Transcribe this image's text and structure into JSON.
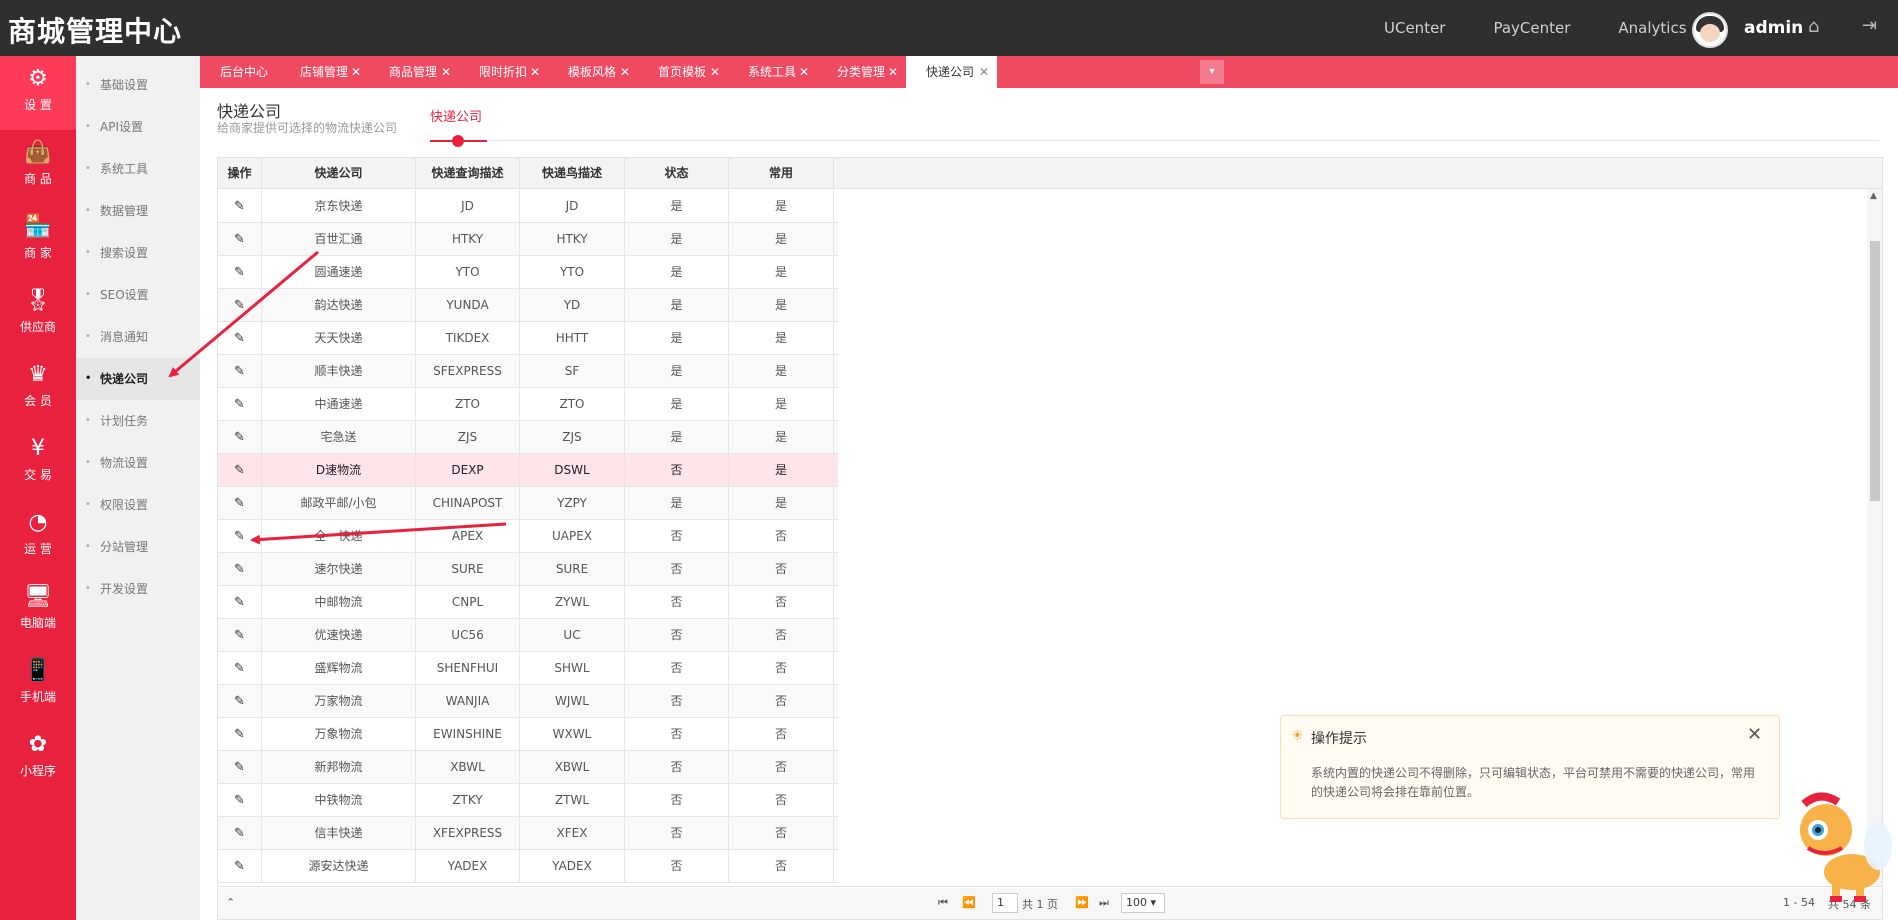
{
  "header": {
    "brand": "商城管理中心",
    "links": [
      "UCenter",
      "PayCenter",
      "Analytics"
    ],
    "username": "admin"
  },
  "mainnav": [
    {
      "label": "设 置",
      "icon": "gear-icon",
      "glyph": "⚙"
    },
    {
      "label": "商 品",
      "icon": "bag-icon",
      "glyph": "👜"
    },
    {
      "label": "商 家",
      "icon": "store-icon",
      "glyph": "🏪"
    },
    {
      "label": "供应商",
      "icon": "badge-icon",
      "glyph": "🎖"
    },
    {
      "label": "会 员",
      "icon": "crown-icon",
      "glyph": "♛"
    },
    {
      "label": "交 易",
      "icon": "yen-icon",
      "glyph": "¥"
    },
    {
      "label": "运 营",
      "icon": "pie-chart-icon",
      "glyph": "◔"
    },
    {
      "label": "电脑端",
      "icon": "monitor-icon",
      "glyph": "🖥"
    },
    {
      "label": "手机端",
      "icon": "phone-icon",
      "glyph": "📱"
    },
    {
      "label": "小程序",
      "icon": "miniprogram-icon",
      "glyph": "✿"
    }
  ],
  "subnav": [
    "基础设置",
    "API设置",
    "系统工具",
    "数据管理",
    "搜索设置",
    "SEO设置",
    "消息通知",
    "快递公司",
    "计划任务",
    "物流设置",
    "权限设置",
    "分站管理",
    "开发设置"
  ],
  "tabs": [
    "后台中心",
    "店铺管理",
    "商品管理",
    "限时折扣",
    "模板风格",
    "首页模板",
    "系统工具",
    "分类管理",
    "快递公司"
  ],
  "page": {
    "title": "快递公司",
    "subtitle": "给商家提供可选择的物流快递公司",
    "tab": "快递公司"
  },
  "table": {
    "columns": [
      "操作",
      "快递公司",
      "快递查询描述",
      "快递鸟描述",
      "状态",
      "常用"
    ],
    "rows": [
      [
        "京东快递",
        "JD",
        "JD",
        "是",
        "是"
      ],
      [
        "百世汇通",
        "HTKY",
        "HTKY",
        "是",
        "是"
      ],
      [
        "圆通速递",
        "YTO",
        "YTO",
        "是",
        "是"
      ],
      [
        "韵达快递",
        "YUNDA",
        "YD",
        "是",
        "是"
      ],
      [
        "天天快递",
        "TIKDEX",
        "HHTT",
        "是",
        "是"
      ],
      [
        "顺丰快递",
        "SFEXPRESS",
        "SF",
        "是",
        "是"
      ],
      [
        "中通速递",
        "ZTO",
        "ZTO",
        "是",
        "是"
      ],
      [
        "宅急送",
        "ZJS",
        "ZJS",
        "是",
        "是"
      ],
      [
        "D速物流",
        "DEXP",
        "DSWL",
        "否",
        "是"
      ],
      [
        "邮政平邮/小包",
        "CHINAPOST",
        "YZPY",
        "是",
        "是"
      ],
      [
        "全一快递",
        "APEX",
        "UAPEX",
        "否",
        "否"
      ],
      [
        "速尔快递",
        "SURE",
        "SURE",
        "否",
        "否"
      ],
      [
        "中邮物流",
        "CNPL",
        "ZYWL",
        "否",
        "否"
      ],
      [
        "优速快递",
        "UC56",
        "UC",
        "否",
        "否"
      ],
      [
        "盛辉物流",
        "SHENFHUI",
        "SHWL",
        "否",
        "否"
      ],
      [
        "万家物流",
        "WANJIA",
        "WJWL",
        "否",
        "否"
      ],
      [
        "万象物流",
        "EWINSHINE",
        "WXWL",
        "否",
        "否"
      ],
      [
        "新邦物流",
        "XBWL",
        "XBWL",
        "否",
        "否"
      ],
      [
        "中铁物流",
        "ZTKY",
        "ZTWL",
        "否",
        "否"
      ],
      [
        "信丰快递",
        "XFEXPRESS",
        "XFEX",
        "否",
        "否"
      ],
      [
        "源安达快递",
        "YADEX",
        "YADEX",
        "否",
        "否"
      ]
    ]
  },
  "pager": {
    "page": "1",
    "total_pages": "共 1 页",
    "page_size": "100",
    "range": "1 - 54",
    "count": "共 54 条"
  },
  "tip": {
    "title": "操作提示",
    "text": "系统内置的快递公司不得删除，只可编辑状态，平台可禁用不需要的快递公司，常用的快递公司将会排在靠前位置。"
  },
  "colors": {
    "accent": "#e8223e",
    "topbar": "#2f2f2f",
    "tabbar": "#f04a63"
  }
}
